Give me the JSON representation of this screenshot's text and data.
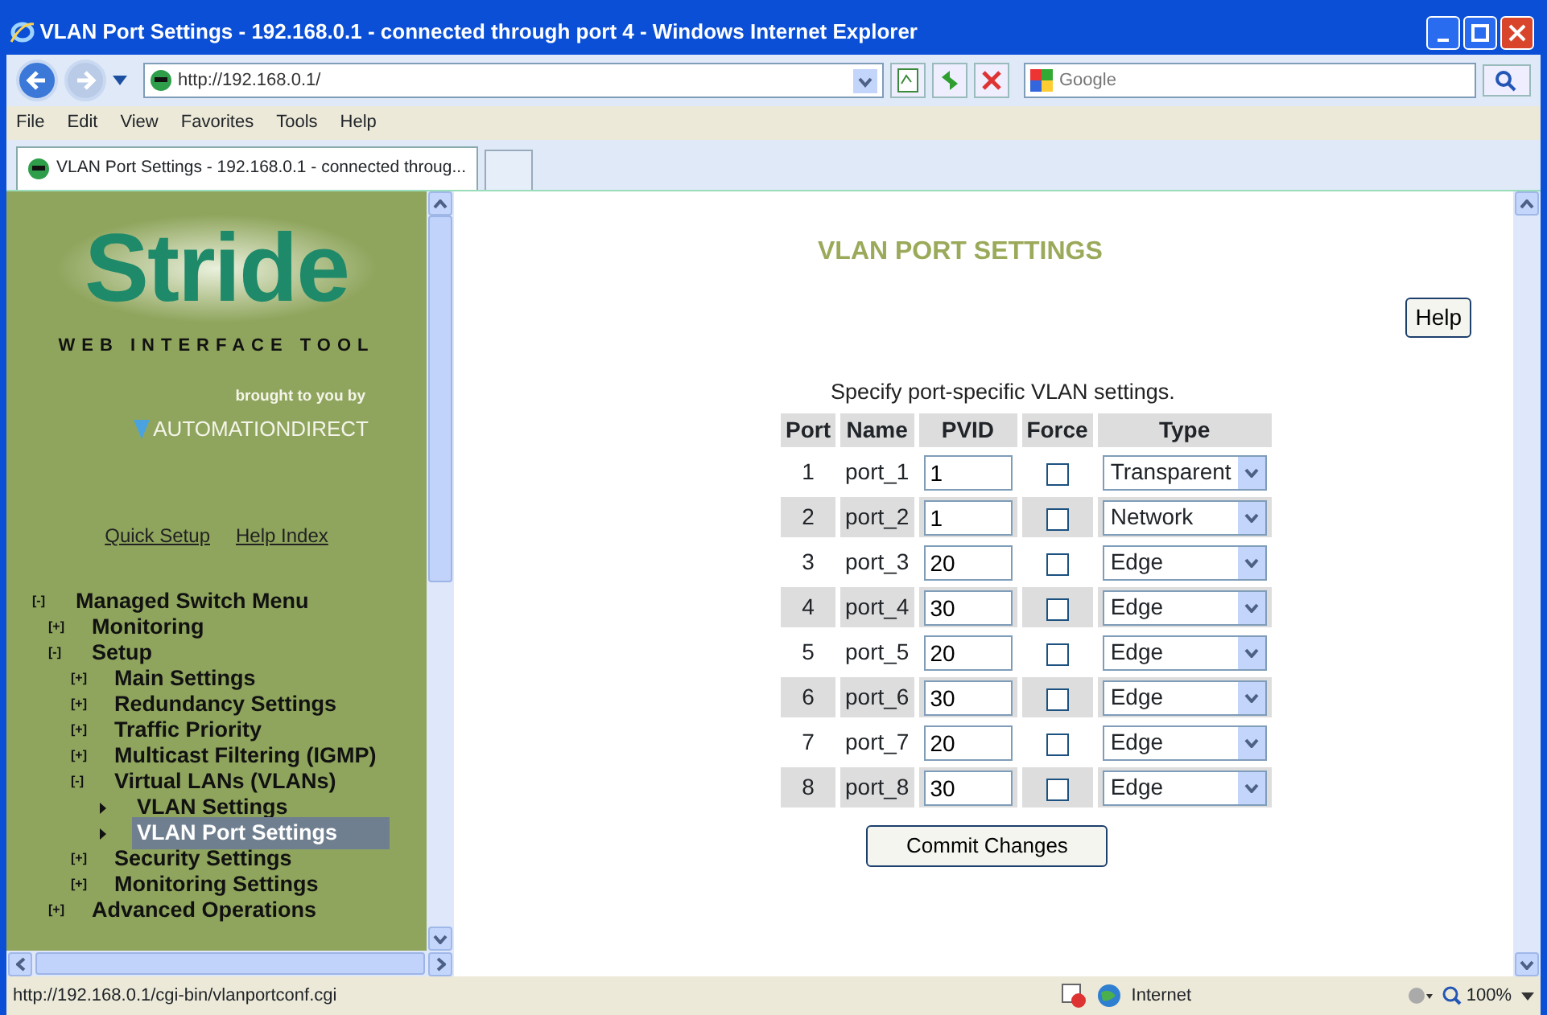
{
  "window": {
    "title": "VLAN Port Settings - 192.168.0.1 - connected through port 4 - Windows Internet Explorer"
  },
  "toolbar": {
    "address": "http://192.168.0.1/",
    "search_placeholder": "Google"
  },
  "menu": [
    "File",
    "Edit",
    "View",
    "Favorites",
    "Tools",
    "Help"
  ],
  "tabs": [
    {
      "label": "VLAN Port Settings - 192.168.0.1 - connected throug...",
      "selected": true
    }
  ],
  "sidebar": {
    "logo": "Stride",
    "logo_subtitle": "WEB INTERFACE TOOL",
    "tagline": "brought to you by",
    "brand": "AUTOMATIONDIRECT",
    "links": [
      "Quick Setup",
      "Help Index"
    ],
    "tree": [
      {
        "toggle": "[-]",
        "label": "Managed Switch Menu",
        "selected": false,
        "children": [
          {
            "toggle": "[+]",
            "label": "Monitoring",
            "selected": false
          },
          {
            "toggle": "[-]",
            "label": "Setup",
            "selected": false,
            "children": [
              {
                "toggle": "[+]",
                "label": "Main Settings",
                "selected": false
              },
              {
                "toggle": "[+]",
                "label": "Redundancy Settings",
                "selected": false
              },
              {
                "toggle": "[+]",
                "label": "Traffic Priority",
                "selected": false
              },
              {
                "toggle": "[+]",
                "label": "Multicast Filtering (IGMP)",
                "selected": false
              },
              {
                "toggle": "[-]",
                "label": "Virtual LANs (VLANs)",
                "selected": false,
                "children": [
                  {
                    "label": "VLAN Settings",
                    "selected": false
                  },
                  {
                    "label": "VLAN Port Settings",
                    "selected": true
                  }
                ]
              },
              {
                "toggle": "[+]",
                "label": "Security Settings",
                "selected": false
              },
              {
                "toggle": "[+]",
                "label": "Monitoring Settings",
                "selected": false
              }
            ]
          },
          {
            "toggle": "[+]",
            "label": "Advanced Operations",
            "selected": false
          }
        ]
      }
    ]
  },
  "main": {
    "title": "VLAN PORT SETTINGS",
    "help_button": "Help",
    "caption": "Specify port-specific VLAN settings.",
    "columns": [
      "Port",
      "Name",
      "PVID",
      "Force",
      "Type"
    ],
    "rows": [
      {
        "port": "1",
        "name": "port_1",
        "pvid": "1",
        "force": false,
        "type": "Transparent"
      },
      {
        "port": "2",
        "name": "port_2",
        "pvid": "1",
        "force": false,
        "type": "Network"
      },
      {
        "port": "3",
        "name": "port_3",
        "pvid": "20",
        "force": false,
        "type": "Edge"
      },
      {
        "port": "4",
        "name": "port_4",
        "pvid": "30",
        "force": false,
        "type": "Edge"
      },
      {
        "port": "5",
        "name": "port_5",
        "pvid": "20",
        "force": false,
        "type": "Edge"
      },
      {
        "port": "6",
        "name": "port_6",
        "pvid": "30",
        "force": false,
        "type": "Edge"
      },
      {
        "port": "7",
        "name": "port_7",
        "pvid": "20",
        "force": false,
        "type": "Edge"
      },
      {
        "port": "8",
        "name": "port_8",
        "pvid": "30",
        "force": false,
        "type": "Edge"
      }
    ],
    "commit_button": "Commit Changes"
  },
  "status_bar": {
    "url": "http://192.168.0.1/cgi-bin/vlanportconf.cgi",
    "zone": "Internet",
    "zoom": "100%"
  }
}
